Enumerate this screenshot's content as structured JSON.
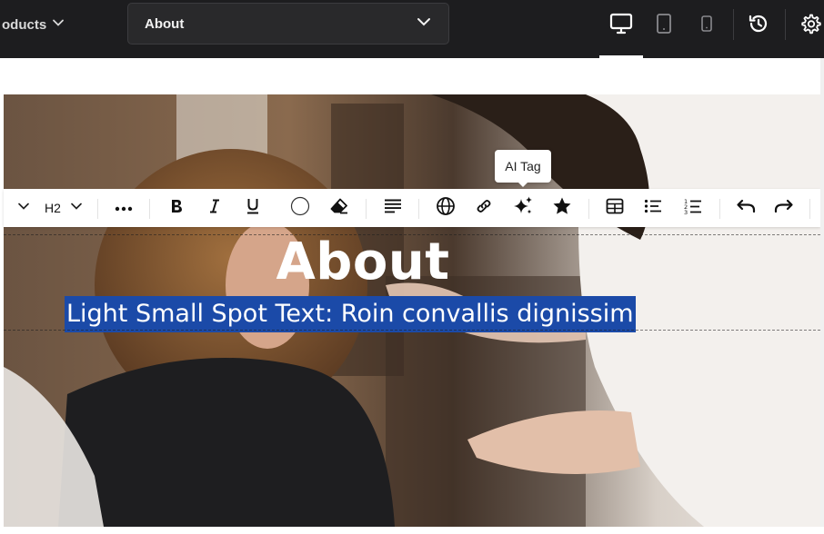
{
  "topbar": {
    "products_label": "oducts",
    "page_select": {
      "value": "About"
    }
  },
  "toolbar": {
    "heading_level": "H2",
    "tooltip": "AI Tag"
  },
  "hero": {
    "title": "About",
    "subtitle": "Light Small Spot Text: Roin convallis dignissim",
    "selection_color": "#1b4aa8"
  },
  "icons": {
    "device": [
      "desktop-icon",
      "tablet-icon",
      "mobile-icon"
    ],
    "right": [
      "history-icon",
      "gear-icon"
    ],
    "toolbar": [
      "chevron-down-icon",
      "more-icon",
      "bold-icon",
      "italic-icon",
      "underline-icon",
      "color-circle-icon",
      "eraser-icon",
      "align-icon",
      "globe-icon",
      "link-icon",
      "sparkle-icon",
      "star-icon",
      "table-icon",
      "bullet-list-icon",
      "numbered-list-icon",
      "undo-icon",
      "redo-icon"
    ]
  }
}
